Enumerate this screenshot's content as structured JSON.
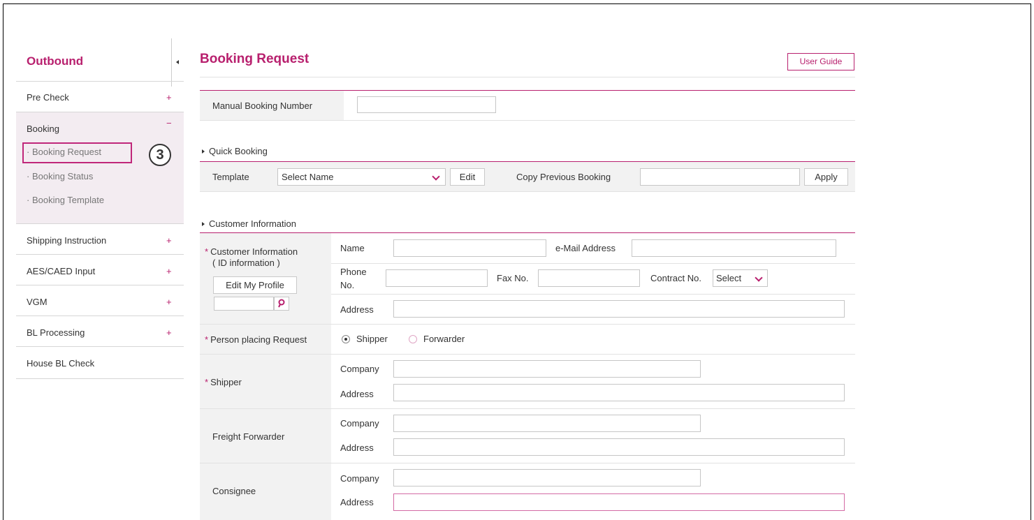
{
  "sidebar": {
    "title": "Outbound",
    "items": [
      {
        "label": "Pre Check",
        "toggle": "+"
      },
      {
        "label": "Booking",
        "toggle": "−"
      },
      {
        "label": "Shipping Instruction",
        "toggle": "+"
      },
      {
        "label": "AES/CAED Input",
        "toggle": "+"
      },
      {
        "label": "VGM",
        "toggle": "+"
      },
      {
        "label": "BL Processing",
        "toggle": "+"
      },
      {
        "label": "House BL Check",
        "toggle": ""
      }
    ],
    "booking_sub": [
      "Booking Request",
      "Booking Status",
      "Booking Template"
    ],
    "step_badge": "3"
  },
  "page": {
    "title": "Booking Request",
    "user_guide": "User Guide"
  },
  "manual": {
    "label": "Manual Booking Number",
    "value": ""
  },
  "quick": {
    "section": "Quick Booking",
    "template_label": "Template",
    "template_value": "Select Name",
    "edit": "Edit",
    "copy_label": "Copy Previous Booking",
    "copy_value": "",
    "apply": "Apply"
  },
  "customer": {
    "section": "Customer Information",
    "label_line1": "Customer Information",
    "label_line2": "( ID information )",
    "edit_profile": "Edit My Profile",
    "id_value": "",
    "name": "Name",
    "email": "e-Mail Address",
    "phone_line1": "Phone",
    "phone_line2": "No.",
    "fax": "Fax No.",
    "contract": "Contract No.",
    "contract_value": "Select",
    "address": "Address"
  },
  "person": {
    "label": "Person placing Request",
    "options": [
      "Shipper",
      "Forwarder"
    ],
    "selected": "Shipper"
  },
  "shipper": {
    "label": "Shipper",
    "company": "Company",
    "address": "Address"
  },
  "forwarder": {
    "label": "Freight Forwarder",
    "company": "Company",
    "address": "Address"
  },
  "consignee": {
    "label": "Consignee",
    "company": "Company",
    "address": "Address"
  },
  "colors": {
    "accent": "#b8206e",
    "sidebar_group_bg": "#f3ecf1",
    "label_bg": "#f2f2f2"
  }
}
